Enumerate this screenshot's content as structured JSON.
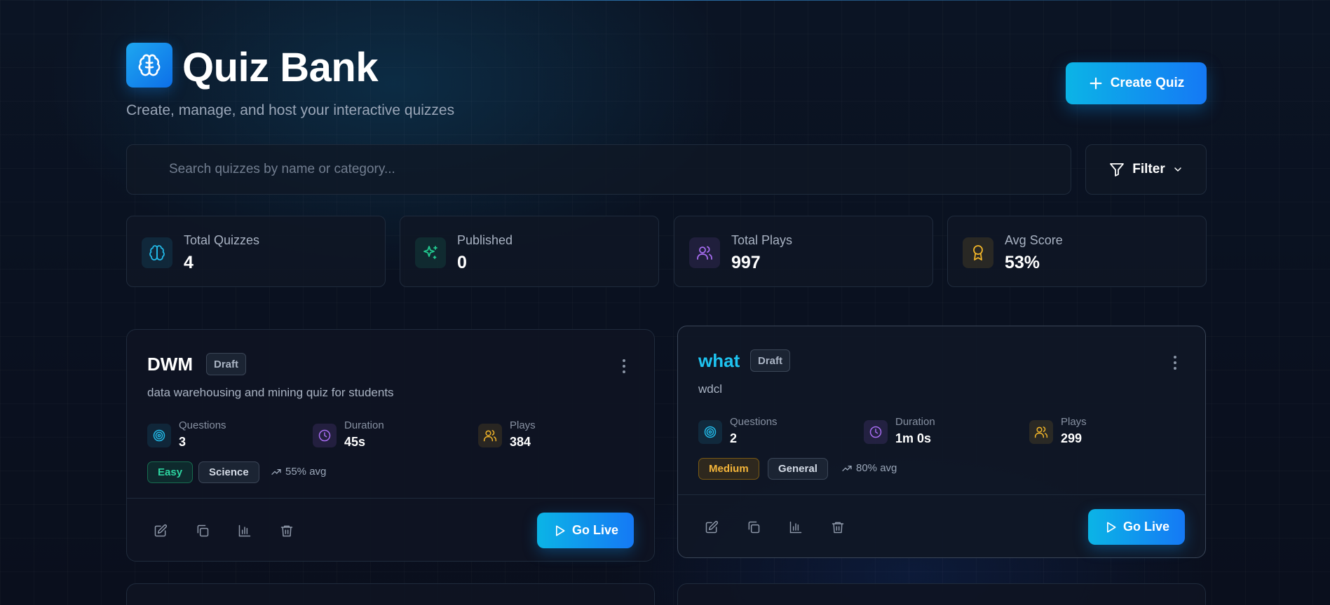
{
  "header": {
    "title": "Quiz Bank",
    "subtitle": "Create, manage, and host your interactive quizzes",
    "logo_icon": "brain-icon",
    "create_button": "Create Quiz"
  },
  "search": {
    "placeholder": "Search quizzes by name or category..."
  },
  "filter": {
    "label": "Filter"
  },
  "stats": [
    {
      "label": "Total Quizzes",
      "value": "4",
      "icon": "brain-icon",
      "color": "#22b8e6"
    },
    {
      "label": "Published",
      "value": "0",
      "icon": "sparkles-icon",
      "color": "#22c98f"
    },
    {
      "label": "Total Plays",
      "value": "997",
      "icon": "users-icon",
      "color": "#a66cf0"
    },
    {
      "label": "Avg Score",
      "value": "53%",
      "icon": "award-icon",
      "color": "#f0b429"
    }
  ],
  "quizzes": [
    {
      "name": "DWM",
      "status": "Draft",
      "description": "data warehousing and mining quiz for students",
      "questions_label": "Questions",
      "questions": "3",
      "duration_label": "Duration",
      "duration": "45s",
      "plays_label": "Plays",
      "plays": "384",
      "difficulty": "Easy",
      "category": "Science",
      "avg": "55% avg",
      "go_live": "Go Live"
    },
    {
      "name": "what",
      "status": "Draft",
      "description": "wdcl",
      "questions_label": "Questions",
      "questions": "2",
      "duration_label": "Duration",
      "duration": "1m 0s",
      "plays_label": "Plays",
      "plays": "299",
      "difficulty": "Medium",
      "category": "General",
      "avg": "80% avg",
      "go_live": "Go Live"
    }
  ],
  "colors": {
    "accent": "#0ea5e9",
    "easy": "#2dd4a0",
    "medium": "#f4b53a"
  }
}
